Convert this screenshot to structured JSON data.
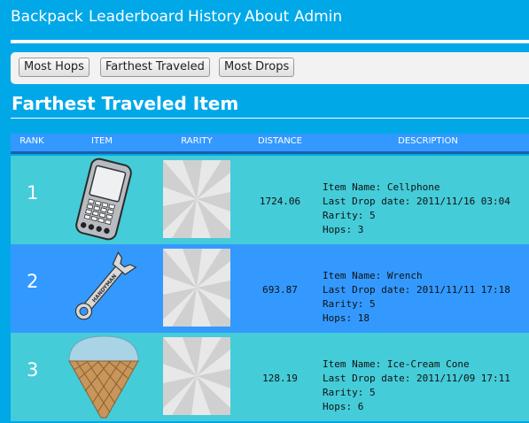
{
  "nav": {
    "items": [
      "Backpack",
      "Leaderboard",
      "History",
      "About",
      "Admin"
    ]
  },
  "filters": {
    "buttons": [
      "Most Hops",
      "Farthest Traveled",
      "Most Drops"
    ]
  },
  "section_title": "Farthest Traveled Item",
  "table": {
    "headers": [
      "RANK",
      "ITEM",
      "RARITY",
      "DISTANCE",
      "DESCRIPTION"
    ],
    "rows": [
      {
        "rank": "1",
        "item_icon": "cellphone-icon",
        "distance": "1724.06",
        "desc": {
          "name": "Item Name: Cellphone",
          "drop": "Last Drop date: 2011/11/16 03:04",
          "rarity": "Rarity: 5",
          "hops": "Hops: 3"
        }
      },
      {
        "rank": "2",
        "item_icon": "wrench-icon",
        "wrench_text": "HANDYMAN",
        "distance": "693.87",
        "desc": {
          "name": "Item Name: Wrench",
          "drop": "Last Drop date: 2011/11/11 17:18",
          "rarity": "Rarity: 5",
          "hops": "Hops: 18"
        }
      },
      {
        "rank": "3",
        "item_icon": "ice-cream-cone-icon",
        "distance": "128.19",
        "desc": {
          "name": "Item Name: Ice-Cream Cone",
          "drop": "Last Drop date: 2011/11/09 17:11",
          "rarity": "Rarity: 5",
          "hops": "Hops: 6"
        }
      }
    ]
  },
  "colors": {
    "page_bg": "#00a8e8",
    "header_row": "#3399ff",
    "row_alt_cyan": "#44ccd8",
    "row_alt_blue": "#3399ff",
    "filter_bar": "#f2f2f2"
  }
}
